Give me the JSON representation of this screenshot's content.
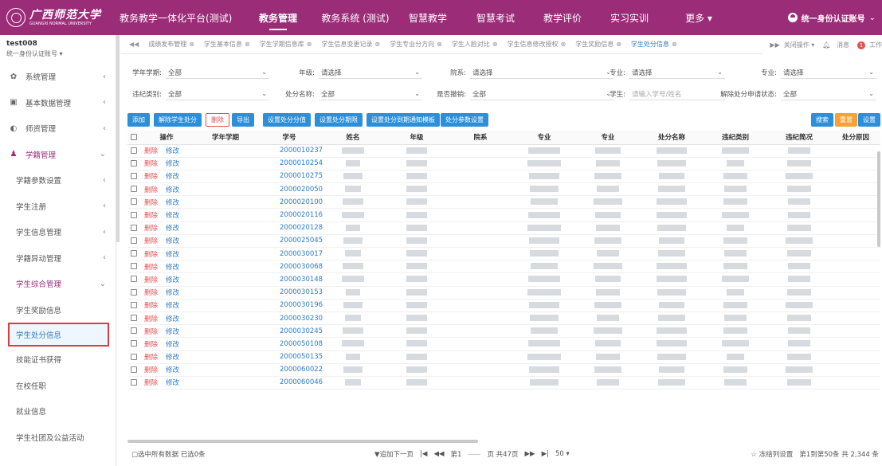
{
  "brand": {
    "logo_cn": "广西师范大学",
    "logo_en": "GUANGXI NORMAL UNIVERSITY",
    "platform": "教务教学一体化平台(测试)"
  },
  "nav": [
    {
      "label": "教务管理",
      "active": true
    },
    {
      "label": "教务系统 (测试)"
    },
    {
      "label": "智慧教学"
    },
    {
      "label": "智慧考试"
    },
    {
      "label": "教学评价"
    },
    {
      "label": "实习实训"
    },
    {
      "label": "更多 ▾"
    }
  ],
  "account": {
    "label": "统一身份认证账号"
  },
  "user": {
    "name": "test008",
    "role": "统一身份认证账号 ▾"
  },
  "sidebar": [
    {
      "icon": "gear-icon",
      "glyph": "✿",
      "label": "系统管理",
      "chev": "‹"
    },
    {
      "icon": "calendar-icon",
      "glyph": "▣",
      "label": "基本数据管理",
      "chev": "‹"
    },
    {
      "icon": "teacher-icon",
      "glyph": "◐",
      "label": "师资管理",
      "chev": "‹"
    },
    {
      "icon": "student-icon",
      "glyph": "♟",
      "label": "学籍管理",
      "chev": "⌄",
      "purple": true
    },
    {
      "label": "学籍参数设置",
      "chev": "‹",
      "sub": true
    },
    {
      "label": "学生注册",
      "chev": "‹",
      "sub": true
    },
    {
      "label": "学生信息管理",
      "chev": "‹",
      "sub": true
    },
    {
      "label": "学籍异动管理",
      "chev": "‹",
      "sub": true
    },
    {
      "label": "学生综合管理",
      "chev": "⌄",
      "sub": true,
      "purple": true
    },
    {
      "label": "学生奖励信息",
      "sub": true
    },
    {
      "label": "学生处分信息",
      "sub": true,
      "selected": true
    },
    {
      "label": "技能证书获得",
      "sub": true
    },
    {
      "label": "在校任职",
      "sub": true
    },
    {
      "label": "就业信息",
      "sub": true
    },
    {
      "label": "学生社团及公益活动",
      "sub": true
    }
  ],
  "tabs": [
    {
      "label": "成绩发布管理"
    },
    {
      "label": "学生基本信息"
    },
    {
      "label": "学生学期信息库"
    },
    {
      "label": "学生信息变更记录"
    },
    {
      "label": "学生专业分方向"
    },
    {
      "label": "学生人脸对比"
    },
    {
      "label": "学生信息修改授权"
    },
    {
      "label": "学生奖励信息"
    },
    {
      "label": "学生处分信息",
      "active": true
    }
  ],
  "tab_controls": {
    "close": "关闭操作 ▾",
    "msg": "消息",
    "work": "工作",
    "badge": "1"
  },
  "filters": {
    "row1": [
      {
        "label": "学年学期:",
        "value": "全部"
      },
      {
        "label": "年级:",
        "value": "请选择"
      },
      {
        "label": "院系:",
        "value": "请选择"
      },
      {
        "label": "专业:",
        "value": "请选择"
      },
      {
        "label": "专业:",
        "value": "请选择"
      }
    ],
    "row2": [
      {
        "label": "违纪类别:",
        "value": "全部"
      },
      {
        "label": "处分名称:",
        "value": "全部"
      },
      {
        "label": "是否撤销:",
        "value": "全部"
      },
      {
        "label": "学生:",
        "value": "请输入学号/姓名"
      },
      {
        "label": "解除处分申请状态:",
        "value": "全部"
      }
    ]
  },
  "toolbar": {
    "add": "添加",
    "lift": "解除学生处分",
    "delete": "删除",
    "export": "导出",
    "set_score": "设置处分分值",
    "set_period": "设置处分期限",
    "set_notice": "设置处分到期通知模板",
    "param": "处分参数设置",
    "search": "搜索",
    "reset": "重置",
    "settings": "设置"
  },
  "table": {
    "headers": [
      "操作",
      "学年学期",
      "学号",
      "姓名",
      "年级",
      "院系",
      "专业",
      "专业",
      "处分名称",
      "违纪类别",
      "违纪简况",
      "处分原因"
    ],
    "del": "删除",
    "edit": "修改",
    "rows": [
      "2000010237",
      "2000010254",
      "2000010275",
      "2000020050",
      "2000020100",
      "2000020116",
      "2000020128",
      "2000025045",
      "2000030017",
      "2000030068",
      "2000030148",
      "2000030153",
      "2000030196",
      "2000030230",
      "2000030245",
      "2000050108",
      "2000050135",
      "2000060022",
      "2000060046"
    ]
  },
  "footer": {
    "left": "▢选中所有数据 已选0条",
    "load_next": "▼追加下一页",
    "page": "第1",
    "page_total": "页 共47页",
    "per_page": "50 ▾",
    "freeze": "☆ 冻结列设置",
    "range": "第1到第50条 共 2,344 条"
  }
}
